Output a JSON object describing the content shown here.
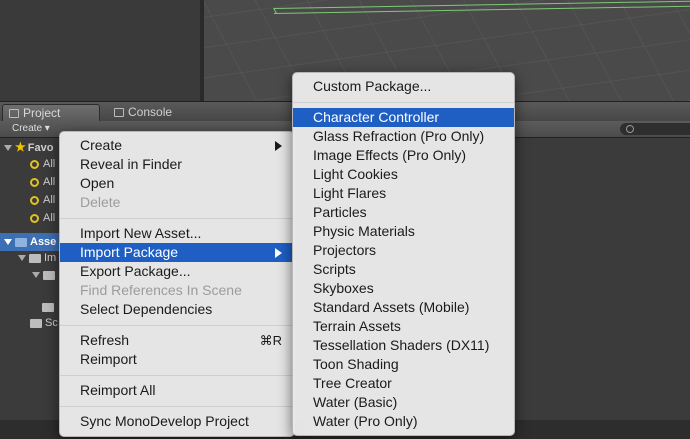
{
  "tabs": [
    {
      "label": "Project",
      "active": true
    },
    {
      "label": "Console",
      "active": false
    }
  ],
  "toolbar": {
    "create_label": "Create ▾"
  },
  "tree": {
    "favorites_label": "Favo",
    "favorite_items": [
      "All",
      "All",
      "All",
      "All"
    ],
    "assets_label": "Asse",
    "sub_items": [
      "Im",
      "",
      "",
      "Sc"
    ]
  },
  "context_menu": {
    "items": [
      {
        "label": "Create",
        "submenu": true
      },
      {
        "label": "Reveal in Finder"
      },
      {
        "label": "Open"
      },
      {
        "label": "Delete",
        "disabled": true
      },
      {
        "label": "Import New Asset..."
      },
      {
        "label": "Import Package",
        "submenu": true,
        "highlight": true
      },
      {
        "label": "Export Package..."
      },
      {
        "label": "Find References In Scene",
        "disabled": true
      },
      {
        "label": "Select Dependencies"
      },
      {
        "label": "Refresh",
        "shortcut": "⌘R"
      },
      {
        "label": "Reimport"
      },
      {
        "label": "Reimport All"
      },
      {
        "label": "Sync MonoDevelop Project"
      }
    ]
  },
  "import_package_menu": {
    "items": [
      {
        "label": "Custom Package..."
      },
      {
        "label": "Character Controller",
        "highlight": true
      },
      {
        "label": "Glass Refraction (Pro Only)"
      },
      {
        "label": "Image Effects (Pro Only)"
      },
      {
        "label": "Light Cookies"
      },
      {
        "label": "Light Flares"
      },
      {
        "label": "Particles"
      },
      {
        "label": "Physic Materials"
      },
      {
        "label": "Projectors"
      },
      {
        "label": "Scripts"
      },
      {
        "label": "Skyboxes"
      },
      {
        "label": "Standard Assets (Mobile)"
      },
      {
        "label": "Terrain Assets"
      },
      {
        "label": "Tessellation Shaders (DX11)"
      },
      {
        "label": "Toon Shading"
      },
      {
        "label": "Tree Creator"
      },
      {
        "label": "Water (Basic)"
      },
      {
        "label": "Water (Pro Only)"
      }
    ]
  },
  "colors": {
    "menu_highlight": "#1f5fc4",
    "selection": "#3d6fb4",
    "gizmo_green": "#7ec87a"
  }
}
